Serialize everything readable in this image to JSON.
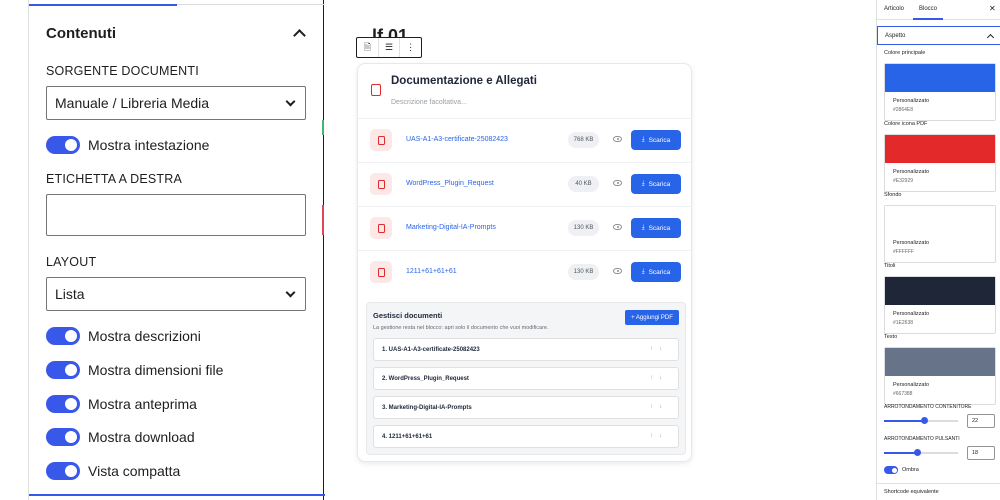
{
  "left_panel": {
    "section_title": "Contenuti",
    "source_label": "SORGENTE DOCUMENTI",
    "source_value": "Manuale / Libreria Media",
    "toggle_header": "Mostra intestazione",
    "right_label": "ETICHETTA A DESTRA",
    "right_label_value": "",
    "layout_label": "LAYOUT",
    "layout_value": "Lista",
    "toggles": [
      "Mostra descrizioni",
      "Mostra dimensioni file",
      "Mostra anteprima",
      "Mostra download",
      "Vista compatta"
    ]
  },
  "canvas": {
    "heading_fragment": "lf 01",
    "card": {
      "title": "Documentazione e Allegati",
      "description": "Descrizione facoltativa...",
      "download_label": "Scarica",
      "documents": [
        {
          "name": "UAS-A1-A3-certificate-25082423",
          "size": "768 KB"
        },
        {
          "name": "WordPress_Plugin_Request",
          "size": "40 KB"
        },
        {
          "name": "Marketing-Digital-IA-Prompts",
          "size": "130 KB"
        },
        {
          "name": "1211+61+61+61",
          "size": "130 KB"
        }
      ]
    },
    "manage": {
      "title": "Gestisci documenti",
      "description": "La gestione resta nel blocco: apri solo il documento che vuoi modificare.",
      "add_button": "+ Aggiungi PDF",
      "items": [
        "1. UAS-A1-A3-certificate-25082423",
        "2. WordPress_Plugin_Request",
        "3. Marketing-Digital-IA-Prompts",
        "4. 1211+61+61+61"
      ]
    }
  },
  "right_panel": {
    "tabs": [
      "Articolo",
      "Blocco"
    ],
    "section_title": "Aspetto",
    "colors": [
      {
        "label": "Colore principale",
        "name": "Personalizzato",
        "hex": "#2864E8",
        "color": "#2864e8"
      },
      {
        "label": "Colore icona PDF",
        "name": "Personalizzato",
        "hex": "#E32929",
        "color": "#e32929"
      },
      {
        "label": "Sfondo",
        "name": "Personalizzato",
        "hex": "#FFFFFF",
        "color": "#ffffff"
      },
      {
        "label": "Titoli",
        "name": "Personalizzato",
        "hex": "#1E2638",
        "color": "#1e2638"
      },
      {
        "label": "Testo",
        "name": "Personalizzato",
        "hex": "#667388",
        "color": "#667388"
      }
    ],
    "radius_container_label": "ARROTONDAMENTO CONTENITORE",
    "radius_container_value": "22",
    "radius_container_level": 0.55,
    "radius_buttons_label": "ARROTONDAMENTO PULSANTI",
    "radius_buttons_value": "18",
    "radius_buttons_level": 0.45,
    "shadow_label": "Ombra",
    "footer_title": "Shortcode equivalente"
  }
}
